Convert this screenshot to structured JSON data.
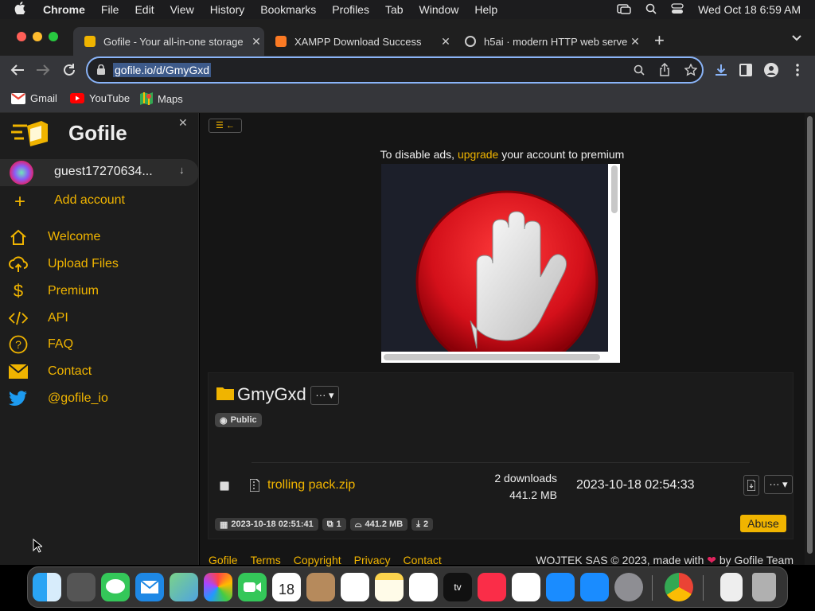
{
  "menubar": {
    "apple": "",
    "app": "Chrome",
    "menus": [
      "File",
      "Edit",
      "View",
      "History",
      "Bookmarks",
      "Profiles",
      "Tab",
      "Window",
      "Help"
    ],
    "datetime": "Wed Oct 18  6:59 AM"
  },
  "tabs": [
    {
      "title": "Gofile - Your all-in-one storage",
      "active": true,
      "color": "#f0b400"
    },
    {
      "title": "XAMPP Download Success",
      "active": false,
      "color": "#fb7a24"
    },
    {
      "title": "h5ai · modern HTTP web server",
      "active": false,
      "color": "#cccccc"
    }
  ],
  "address": {
    "url": "gofile.io/d/GmyGxd"
  },
  "bookmarks": [
    {
      "label": "Gmail",
      "color": "#ea4335"
    },
    {
      "label": "YouTube",
      "color": "#ff0000"
    },
    {
      "label": "Maps",
      "color": "#34a853"
    }
  ],
  "sidebar": {
    "brand": "Gofile",
    "account": "guest17270634...",
    "add_account": "Add account",
    "items": [
      {
        "label": "Welcome",
        "icon": "home-icon"
      },
      {
        "label": "Upload Files",
        "icon": "cloud-upload-icon"
      },
      {
        "label": "Premium",
        "icon": "dollar-icon"
      },
      {
        "label": "API",
        "icon": "code-icon"
      },
      {
        "label": "FAQ",
        "icon": "question-icon"
      },
      {
        "label": "Contact",
        "icon": "envelope-icon"
      },
      {
        "label": "@gofile_io",
        "icon": "twitter-icon"
      }
    ]
  },
  "ads": {
    "prefix": "To disable ads, ",
    "link": "upgrade",
    "suffix": " your account to premium"
  },
  "folder": {
    "name": "GmyGxd",
    "menu": "···",
    "visibility": "Public",
    "created": "2023-10-18 02:51:41",
    "children_count": "1",
    "total_size": "441.2 MB",
    "downloads": "2",
    "abuse": "Abuse"
  },
  "file": {
    "name": "trolling pack.zip",
    "downloads": "2 downloads",
    "size": "441.2 MB",
    "date": "2023-10-18 02:54:33",
    "menu": "···"
  },
  "footer": {
    "links": [
      "Gofile",
      "Terms",
      "Copyright",
      "Privacy",
      "Contact"
    ],
    "credit_prefix": "WOJTEK SAS © 2023, made with",
    "credit_suffix": "by Gofile Team"
  },
  "colors": {
    "accent": "#f0b400",
    "abuse": "#f0b400",
    "stop_red": "#d4101a"
  }
}
